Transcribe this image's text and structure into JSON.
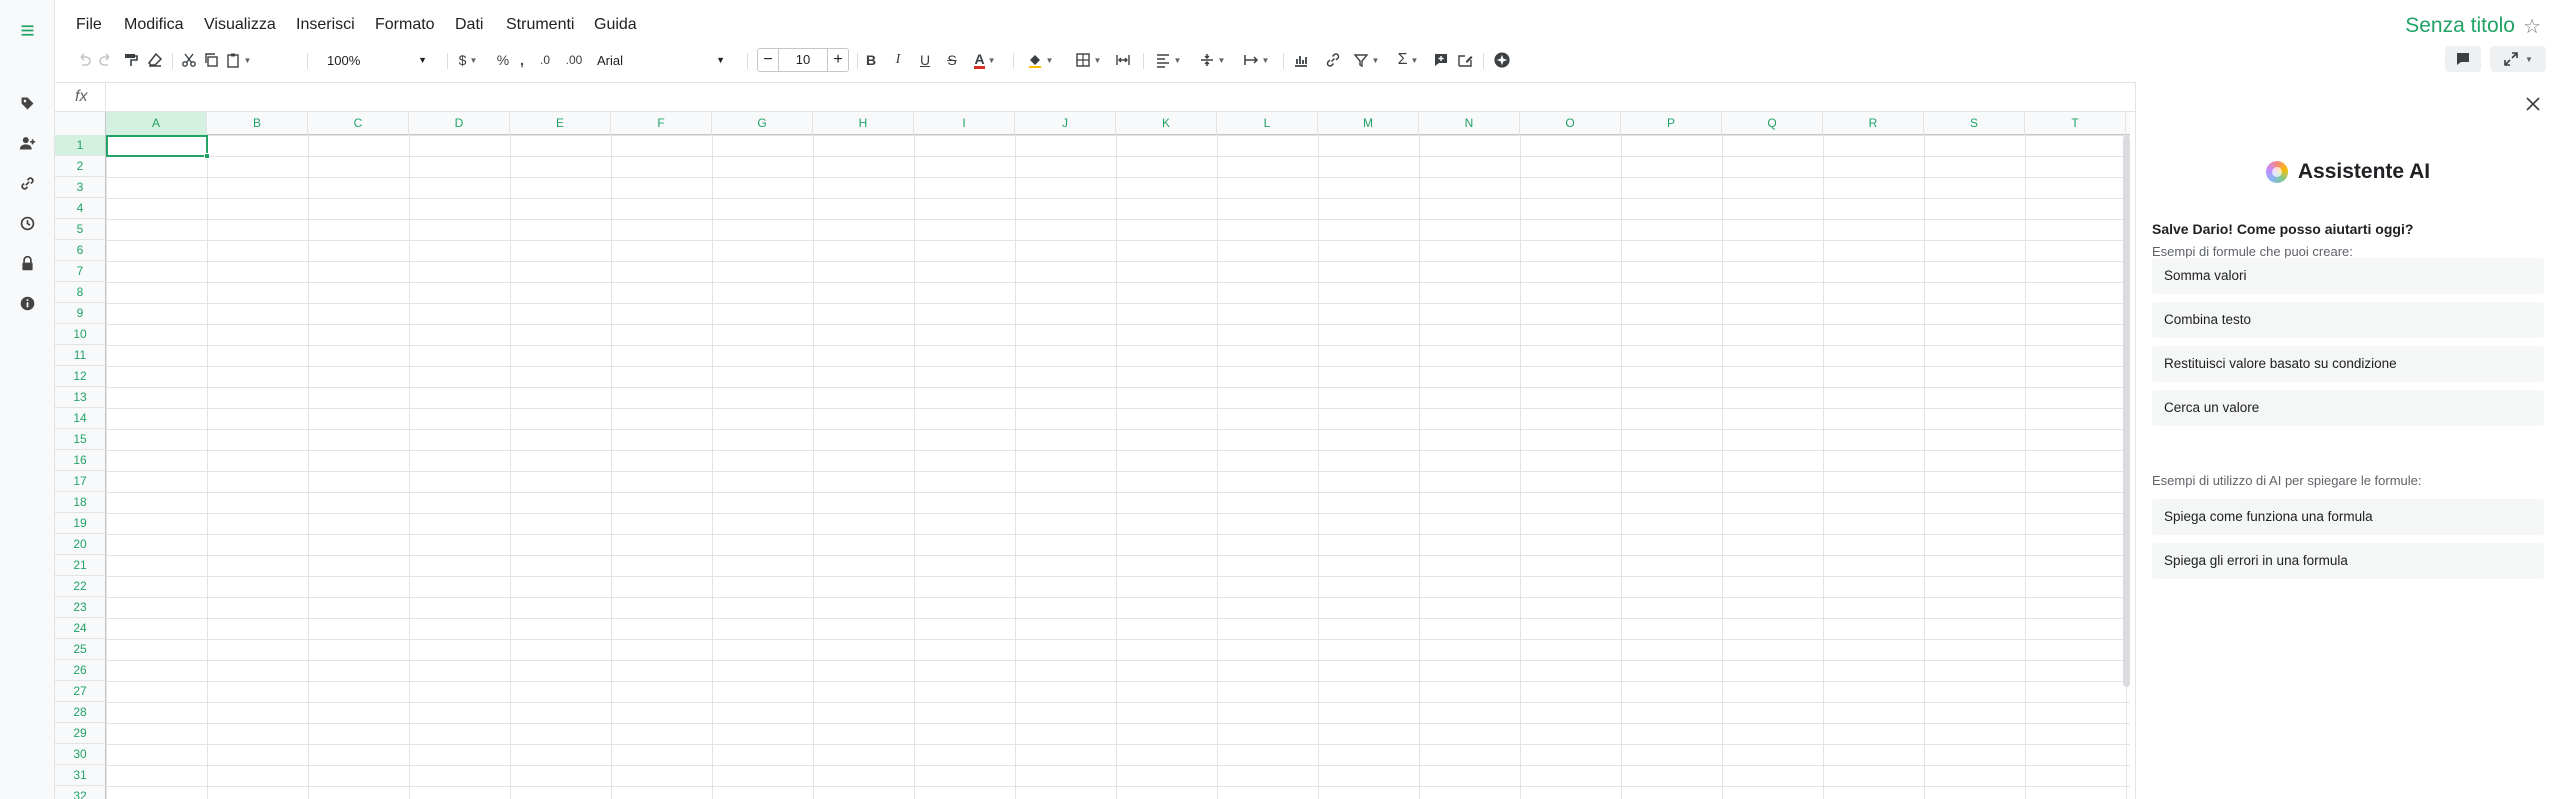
{
  "menu": [
    "File",
    "Modifica",
    "Visualizza",
    "Inserisci",
    "Formato",
    "Dati",
    "Strumenti",
    "Guida"
  ],
  "doc_title": "Senza titolo",
  "toolbar": {
    "zoom": "100%",
    "currency_symbol": "$",
    "percent_symbol": "%",
    "comma_symbol": ",",
    "decrease_decimals": ".0",
    "increase_decimals": ".00",
    "font": "Arial",
    "font_size": "10",
    "bold": "B",
    "italic": "I",
    "underline": "U",
    "strike": "S",
    "text_color": "A"
  },
  "formula_bar": {
    "fx": "fx",
    "value": ""
  },
  "columns": [
    "A",
    "B",
    "C",
    "D",
    "E",
    "F",
    "G",
    "H",
    "I",
    "J",
    "K",
    "L",
    "M",
    "N",
    "O",
    "P",
    "Q",
    "R",
    "S",
    "T"
  ],
  "rows": [
    "1",
    "2",
    "3",
    "4",
    "5",
    "6",
    "7",
    "8",
    "9",
    "10",
    "11",
    "12",
    "13",
    "14",
    "15",
    "16",
    "17",
    "18",
    "19",
    "20",
    "21",
    "22",
    "23",
    "24",
    "25",
    "26",
    "27",
    "28",
    "29",
    "30",
    "31",
    "32"
  ],
  "selected_cell": "A1",
  "ai_panel": {
    "title": "Assistente AI",
    "greeting": "Salve Dario! Come posso aiutarti oggi?",
    "formulas_heading": "Esempi di formule che puoi creare:",
    "formula_examples": [
      "Somma valori",
      "Combina testo",
      "Restituisci valore basato su condizione",
      "Cerca un valore"
    ],
    "explain_heading": "Esempi di utilizzo di AI per spiegare le formule:",
    "explain_examples": [
      "Spiega come funziona una formula",
      "Spiega gli errori in una formula"
    ]
  },
  "colors": {
    "accent": "#21a366",
    "selection_bg": "#d3f0e0"
  }
}
